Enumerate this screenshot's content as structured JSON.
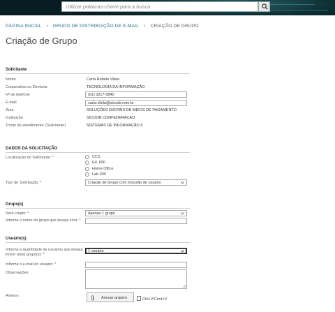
{
  "search": {
    "placeholder": "Utilizar palavras-chave para a busca"
  },
  "breadcrumb": {
    "items": [
      "PÁGINA INICIAL",
      "GRUPO DE DISTRIBUIÇÃO DE E-MAIL"
    ],
    "current": "CRIAÇÃO DE GRUPO"
  },
  "page": {
    "title": "Criação de Grupo"
  },
  "solicitante": {
    "section_title": "Solicitante",
    "fields": [
      {
        "label": "Nome",
        "value": "Carla Rabelo Vilela"
      },
      {
        "label": "Cooperativa ou Diretoria",
        "value": "TECNOLOGIA DA INFORMAÇÃO"
      },
      {
        "label": "Nº de telefone",
        "value": "(61) 3217-5840"
      },
      {
        "label": "E-mail",
        "value": "carla.vilela@sicoob.com.br"
      },
      {
        "label": "Área",
        "value": "SOLUÇÕES DIGITAIS DE MEIOS DE PAGAMENTO"
      },
      {
        "label": "Instituição",
        "value": "SICOOB CONFEDERACAO"
      },
      {
        "label": "'Posto de atendimento' (Solicitante)",
        "value": "SISTEMAS DE INFORMAÇÃO II"
      }
    ]
  },
  "solicitacao": {
    "section_title": "DADOS DA SOLICITAÇÃO",
    "localizacao_label": "Localização do Solicitante: *",
    "localizacao_options": [
      "CCS",
      "Ed. 600",
      "Home Office",
      "Lab 300"
    ],
    "tipo_label": "Tipo de Solicitação: *",
    "tipo_value": "Criação de Grupo com Inclusão de usuário"
  },
  "grupos": {
    "section_title": "Grupo(s)",
    "sera_criado_label": "Será criado: *",
    "sera_criado_value": "Apenas 1 grupo",
    "nome_label": "Informe o nome do grupo que deseja criar: *",
    "nome_value": ""
  },
  "usuarios": {
    "section_title": "Usuário(s)",
    "quantidade_label": "Informe a quantidade de usuários que deseja incluir ao(s) grupo(s): *",
    "quantidade_value": "1 usuário",
    "email_label": "Informe o e-mail do usuário: *",
    "email_value": "",
    "obs_label": "Observações:",
    "anexos_label": "Anexos:",
    "anexar_button": "Anexar arquivo",
    "paste_hint": "Ctrl+V/Cmd+V"
  }
}
